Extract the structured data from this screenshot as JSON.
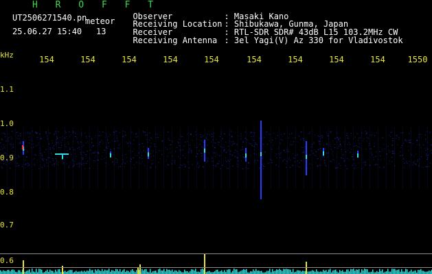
{
  "header": {
    "title": "H R O F F T",
    "filename": "UT2506271540.pn",
    "suffix": "meteor",
    "datetime": "25.06.27 15:40",
    "count": "13"
  },
  "info": [
    {
      "key": "Observer",
      "value": ": Masaki Kano"
    },
    {
      "key": "Receiving Location",
      "value": ": Shibukawa, Gunma, Japan"
    },
    {
      "key": "Receiver",
      "value": ": RTL-SDR SDR# 43dB L15 103.2MHz CW"
    },
    {
      "key": "Receiving Antenna",
      "value": ": 3el Yagi(V) Az 330 for Vladivostok"
    }
  ],
  "axis": {
    "unit": "kHz",
    "x_ticks": [
      "154",
      "154",
      "154",
      "154",
      "154",
      "154",
      "154",
      "154",
      "154",
      "1550"
    ],
    "y_ticks": [
      "1.1",
      "1.0",
      "0.9",
      "0.8",
      "0.7",
      "0.6"
    ]
  },
  "colors": {
    "text": "#ffffff",
    "accent_green": "#3ddc4a",
    "axis_yellow": "#e8e83a",
    "signal_blue": "#2a3cff",
    "signal_cyan": "#2fe0e0",
    "signal_red": "#ff3030"
  }
}
